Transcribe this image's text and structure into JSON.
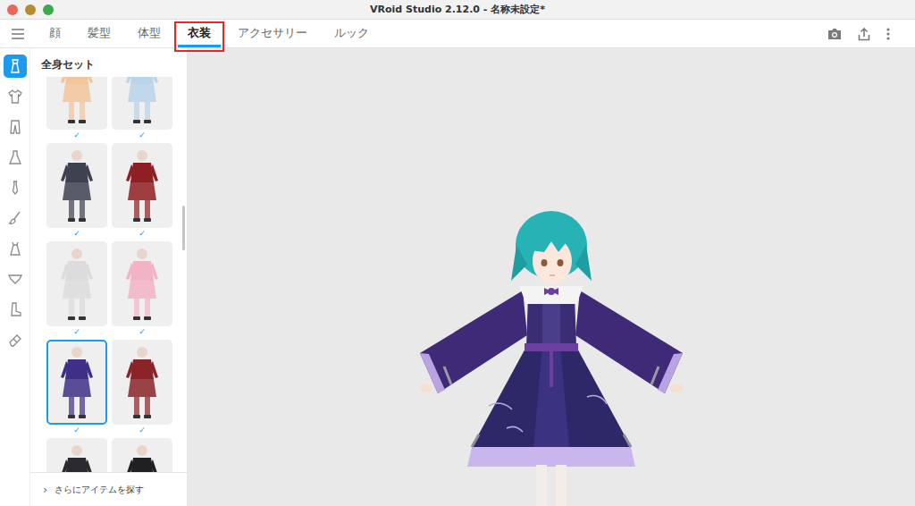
{
  "window": {
    "title": "VRoid Studio 2.12.0 - 名称未設定*"
  },
  "tabs": [
    {
      "label": "顔",
      "selected": false,
      "annotated": false
    },
    {
      "label": "髪型",
      "selected": false,
      "annotated": false
    },
    {
      "label": "体型",
      "selected": false,
      "annotated": false
    },
    {
      "label": "衣装",
      "selected": true,
      "annotated": true
    },
    {
      "label": "アクセサリー",
      "selected": false,
      "annotated": false
    },
    {
      "label": "ルック",
      "selected": false,
      "annotated": false
    }
  ],
  "rail": [
    {
      "kind": "fullset",
      "selected": true
    },
    {
      "kind": "shirt",
      "selected": false
    },
    {
      "kind": "pants",
      "selected": false
    },
    {
      "kind": "dress",
      "selected": false
    },
    {
      "kind": "tie",
      "selected": false
    },
    {
      "kind": "brush",
      "selected": false
    },
    {
      "kind": "onepiece",
      "selected": false
    },
    {
      "kind": "underwear",
      "selected": false
    },
    {
      "kind": "boots",
      "selected": false
    },
    {
      "kind": "eraser",
      "selected": false
    }
  ],
  "panel": {
    "title": "全身セット",
    "more_icon": "›",
    "more": "さらにアイテムを探す",
    "check_mark": "✓"
  },
  "items": [
    {
      "checked": false,
      "selected": false,
      "color": "#f2c49b"
    },
    {
      "checked": false,
      "selected": false,
      "color": "#b9d3ea"
    },
    {
      "checked": true,
      "selected": false,
      "color": "#3d4150"
    },
    {
      "checked": true,
      "selected": false,
      "color": "#8e1f22"
    },
    {
      "checked": true,
      "selected": false,
      "color": "#dcdcdc"
    },
    {
      "checked": true,
      "selected": false,
      "color": "#f2b3c5"
    },
    {
      "checked": true,
      "selected": true,
      "color": "#3f2f86"
    },
    {
      "checked": true,
      "selected": false,
      "color": "#8a2428"
    },
    {
      "checked": true,
      "selected": false,
      "color": "#2a2a2e"
    },
    {
      "checked": true,
      "selected": false,
      "color": "#1f1f24"
    }
  ]
}
